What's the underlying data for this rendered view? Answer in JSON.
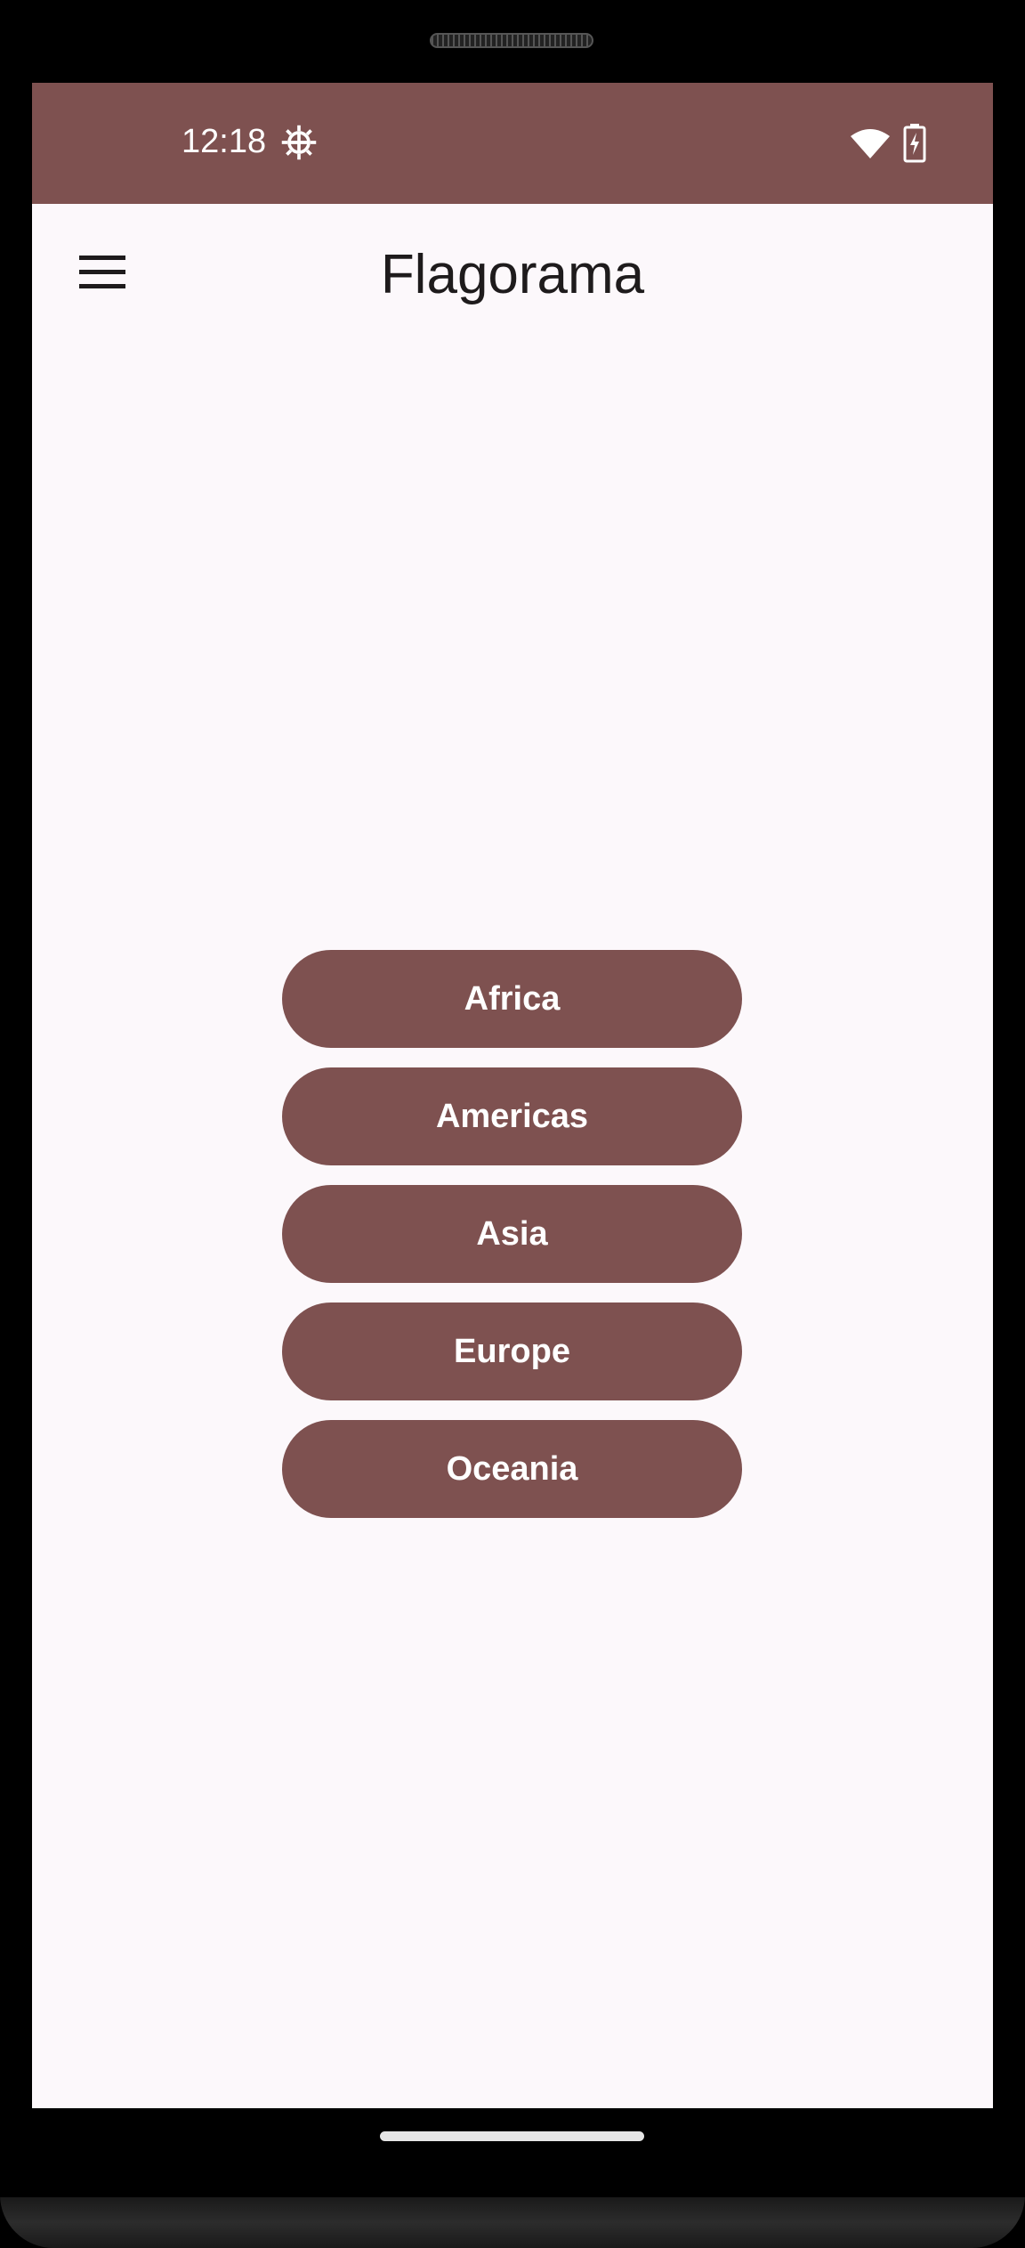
{
  "status_bar": {
    "time": "12:18",
    "icons": [
      "settings-gear-icon",
      "wifi-icon",
      "battery-charging-icon"
    ]
  },
  "app_bar": {
    "title": "Flagorama",
    "menu_icon": "hamburger-menu-icon"
  },
  "regions": {
    "africa": "Africa",
    "americas": "Americas",
    "asia": "Asia",
    "europe": "Europe",
    "oceania": "Oceania"
  },
  "colors": {
    "primary": "#7e5150",
    "background": "#fcf8fb",
    "on_primary": "#ffffff",
    "title_text": "#1e1b1c"
  }
}
